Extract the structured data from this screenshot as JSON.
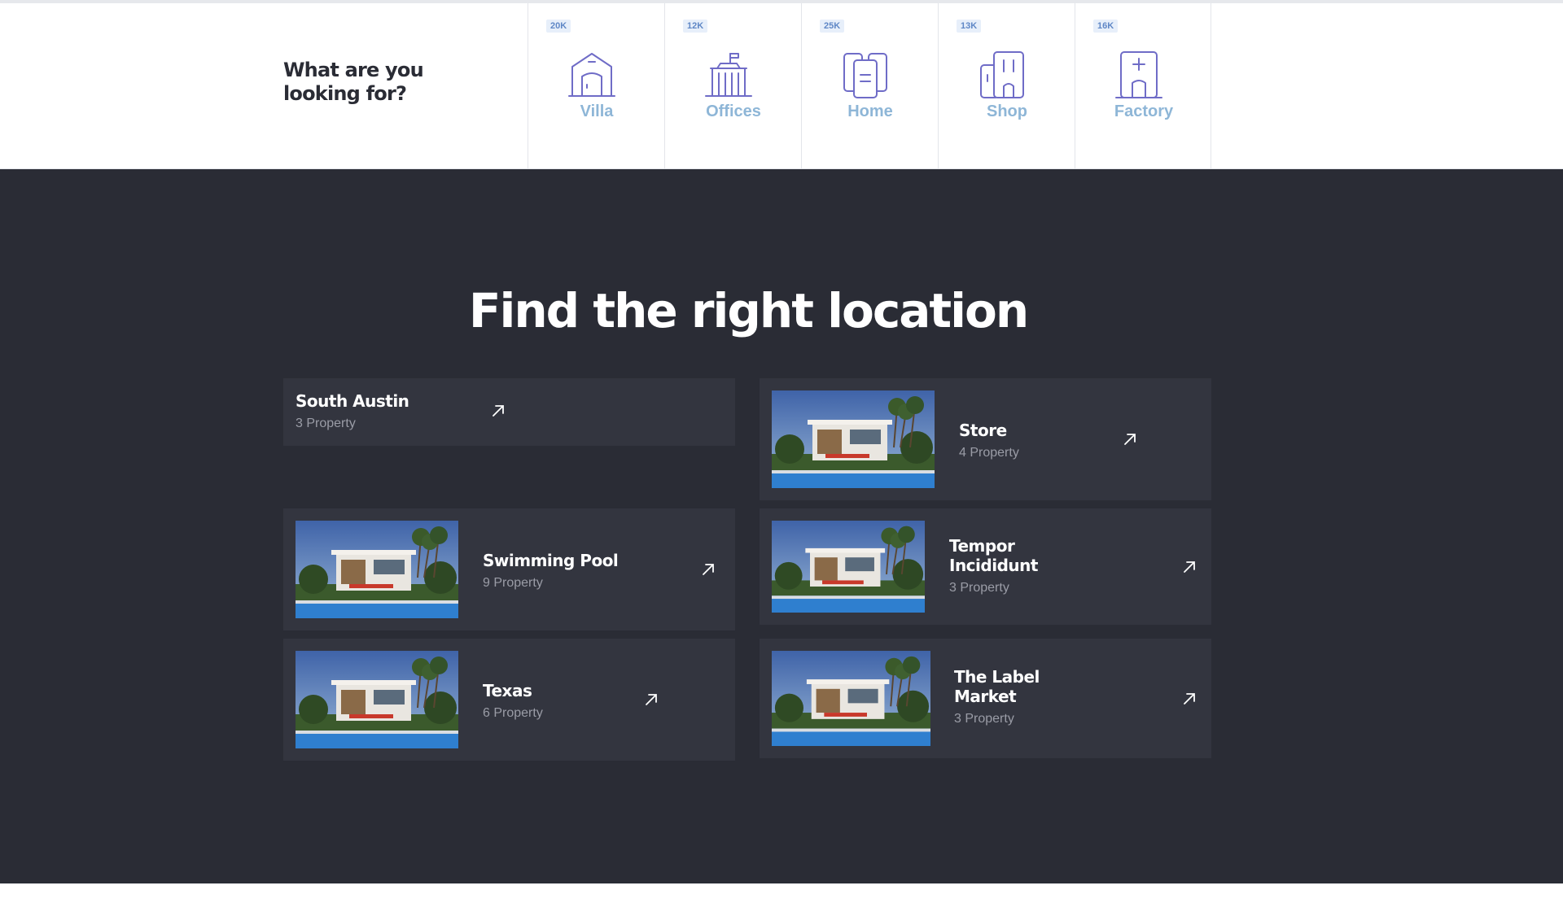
{
  "categories": {
    "heading": "What are you looking for?",
    "items": [
      {
        "count": "20K",
        "label": "Villa",
        "icon": "villa-icon"
      },
      {
        "count": "12K",
        "label": "Offices",
        "icon": "offices-icon"
      },
      {
        "count": "25K",
        "label": "Home",
        "icon": "home-icon"
      },
      {
        "count": "13K",
        "label": "Shop",
        "icon": "shop-icon"
      },
      {
        "count": "16K",
        "label": "Factory",
        "icon": "factory-icon"
      }
    ]
  },
  "locations": {
    "title": "Find the right location",
    "cards": [
      {
        "name": "South Austin",
        "count": "3 Property",
        "has_image": false
      },
      {
        "name": "Store",
        "count": "4 Property",
        "has_image": true
      },
      {
        "name": "Swimming Pool",
        "count": "9 Property",
        "has_image": true
      },
      {
        "name": "Tempor Incididunt",
        "count": "3 Property",
        "has_image": true
      },
      {
        "name": "Texas",
        "count": "6 Property",
        "has_image": true
      },
      {
        "name": "The Label Market",
        "count": "3 Property",
        "has_image": true
      }
    ]
  },
  "colors": {
    "accent_icon": "#6f6cc7",
    "label_blue": "#8eb6d7",
    "dark_bg": "#2a2c35",
    "card_bg": "#33353f"
  }
}
